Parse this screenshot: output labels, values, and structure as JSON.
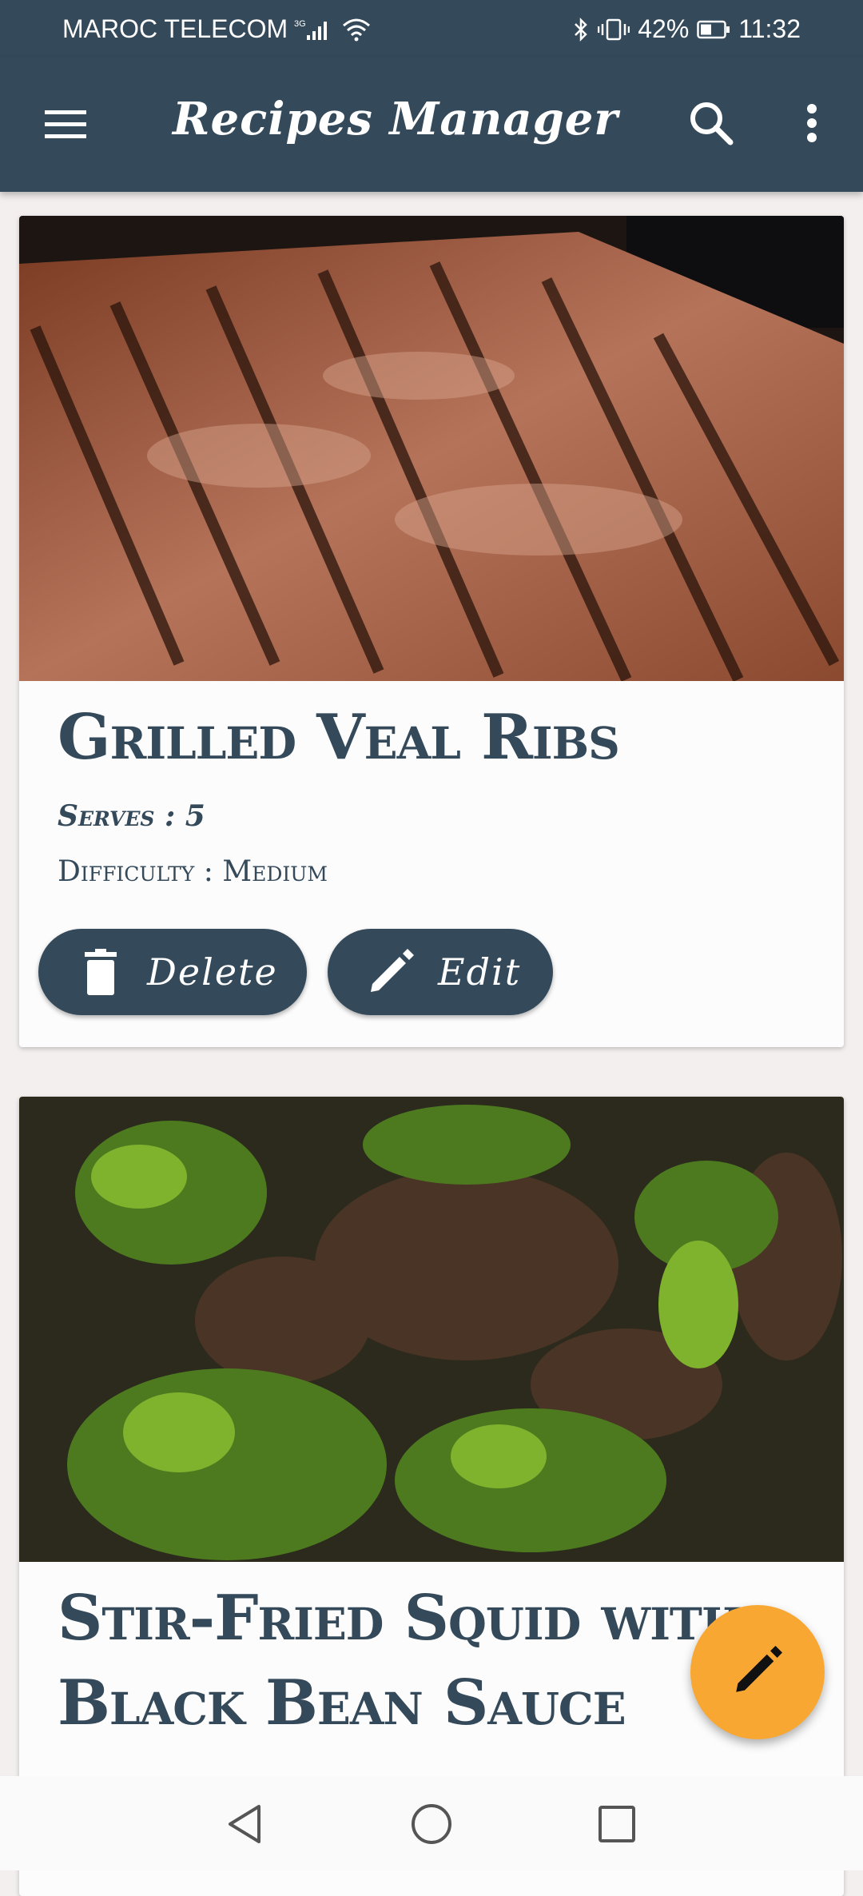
{
  "status": {
    "carrier": "MAROC TELECOM",
    "network": "3G",
    "battery": "42%",
    "time": "11:32"
  },
  "appbar": {
    "title": "Recipes Manager",
    "menu_icon": "hamburger-menu-icon",
    "search_icon": "search-icon",
    "more_icon": "more-vert-icon"
  },
  "recipes": [
    {
      "title": "Grilled Veal Ribs",
      "serves": "Serves : 5",
      "difficulty": "Difficulty : Medium",
      "delete_label": "Delete",
      "edit_label": "Edit"
    },
    {
      "title": "Stir-Fried Squid with Black Bean Sauce"
    }
  ],
  "fab": {
    "icon": "pencil-icon"
  },
  "colors": {
    "primary": "#34495a",
    "accent": "#f8a832",
    "background": "#f3efef"
  }
}
